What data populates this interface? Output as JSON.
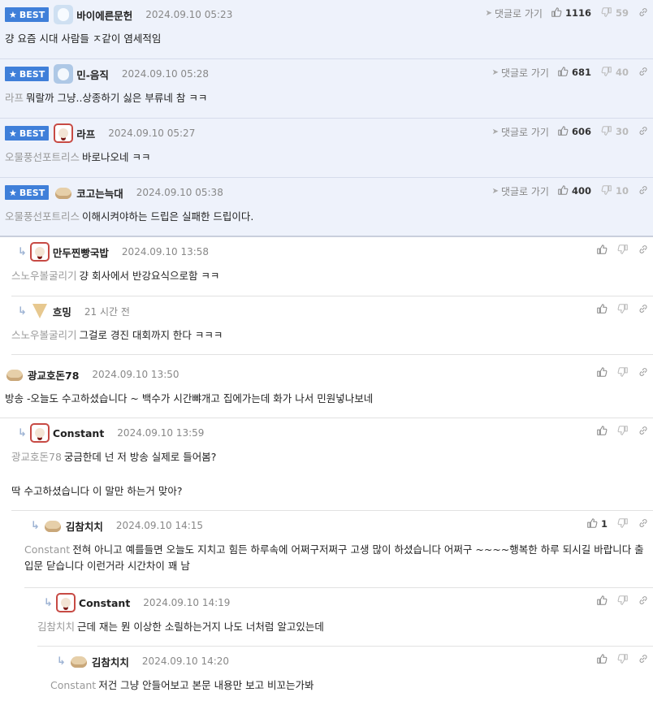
{
  "labels": {
    "best": "BEST",
    "reply_to": "댓글로 가기"
  },
  "comments": [
    {
      "nick": "바이에른문헌",
      "date": "2024.09.10 05:23",
      "mention": "",
      "text": "걍 요즘 시대 사람들 ㅈ같이 염세적임",
      "up": "1116",
      "down": "59"
    },
    {
      "nick": "민-음직",
      "date": "2024.09.10 05:28",
      "mention": "라프",
      "text": "뭐랄까 그냥..상종하기 싫은 부류네 참 ㅋㅋ",
      "up": "681",
      "down": "40"
    },
    {
      "nick": "라프",
      "date": "2024.09.10 05:27",
      "mention": "오물풍선포트리스",
      "text": "바로나오네 ㅋㅋ",
      "up": "606",
      "down": "30"
    },
    {
      "nick": "코고는늑대",
      "date": "2024.09.10 05:38",
      "mention": "오물풍선포트리스",
      "text": "이해시켜야하는 드립은 실패한 드립이다.",
      "up": "400",
      "down": "10"
    },
    {
      "nick": "만두찐빵국밥",
      "date": "2024.09.10 13:58",
      "mention": "스노우볼굴리기",
      "text": "걍 회사에서 반강요식으로함 ㅋㅋ",
      "up": "",
      "down": ""
    },
    {
      "nick": "흐밍",
      "date": "21 시간 전",
      "mention": "스노우볼굴리기",
      "text": "그걸로 경진 대회까지 한다 ㅋㅋㅋ",
      "up": "",
      "down": ""
    },
    {
      "nick": "광교호돈78",
      "date": "2024.09.10 13:50",
      "mention": "",
      "text": "방송 -오늘도 수고하셨습니다 ~ 백수가 시간뺘개고 집에가는데 화가 나서 민원넣나보네",
      "up": "",
      "down": ""
    },
    {
      "nick": "Constant",
      "date": "2024.09.10 13:59",
      "mention": "광교호돈78",
      "text": "궁금한데 넌 저 방송 실제로 들어봄?",
      "text2": "딱 수고하셨습니다 이 말만 하는거 맞아?",
      "up": "",
      "down": ""
    },
    {
      "nick": "김참치치",
      "date": "2024.09.10 14:15",
      "mention": "Constant",
      "text": "전혀 아니고 예를들면 오늘도 지치고 힘든 하루속에 어쩌구저쩌구 고생 많이 하셨습니다 어쩌구 ~~~~행복한 하루 되시길 바랍니다 출입문 닫습니다 이런거라 시간차이 꽤 남",
      "up": "1",
      "down": ""
    },
    {
      "nick": "Constant",
      "date": "2024.09.10 14:19",
      "mention": "김참치치",
      "text": "근데 재는 뭔 이상한 소릴하는거지 나도 너처럼 알고있는데",
      "up": "",
      "down": ""
    },
    {
      "nick": "김참치치",
      "date": "2024.09.10 14:20",
      "mention": "Constant",
      "text": "저건 그냥 안들어보고 본문 내용만 보고 비꼬는가봐",
      "up": "",
      "down": ""
    }
  ]
}
